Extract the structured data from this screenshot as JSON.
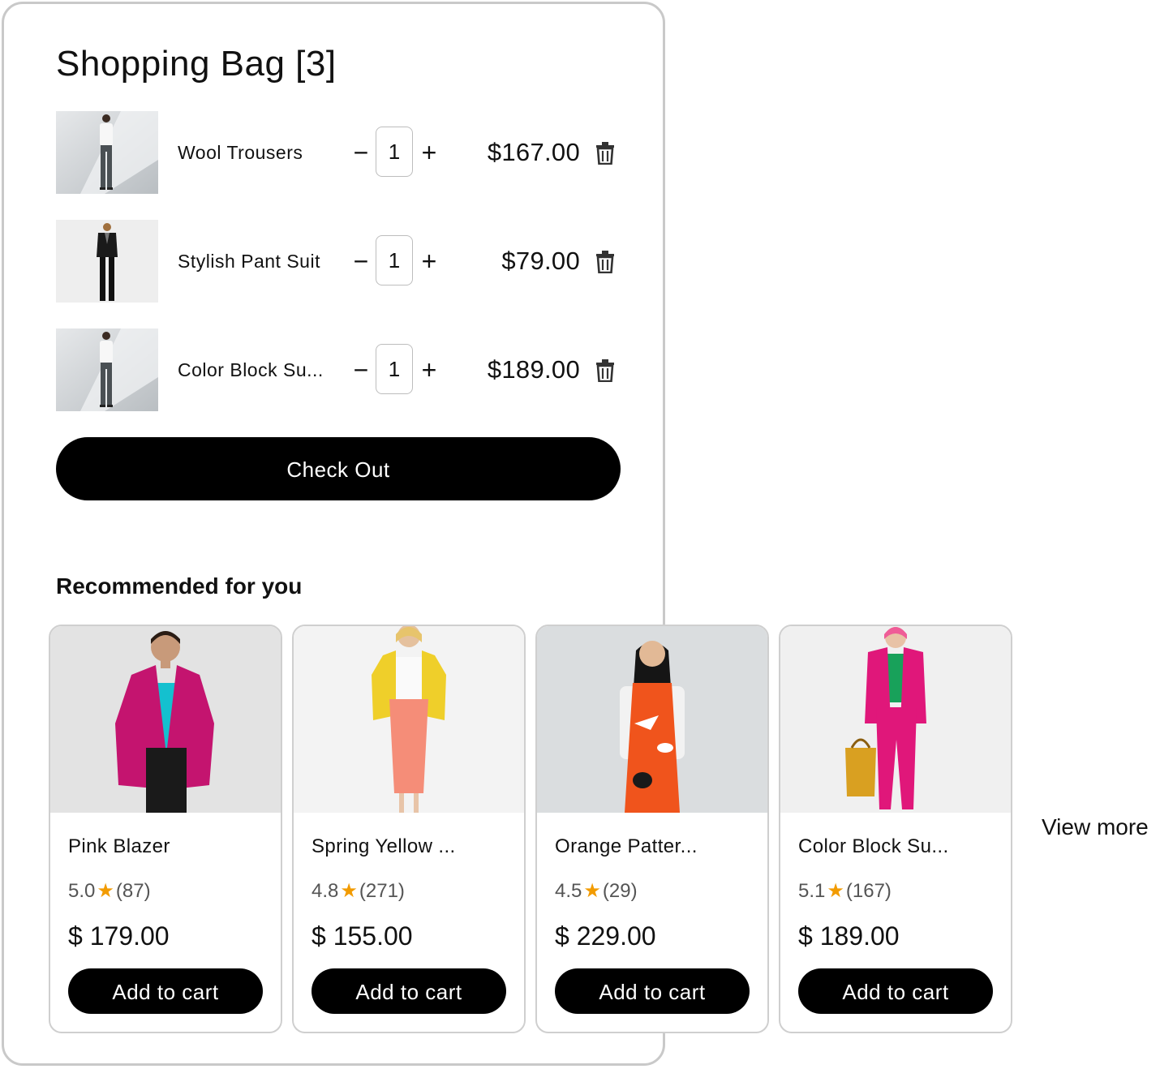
{
  "bag": {
    "title": "Shopping Bag [3]",
    "items": [
      {
        "name": "Wool Trousers",
        "qty": "1",
        "price": "$167.00",
        "image": "woman-white-shirt-gray-trousers"
      },
      {
        "name": "Stylish Pant Suit",
        "qty": "1",
        "price": "$79.00",
        "image": "woman-black-pant-suit"
      },
      {
        "name": "Color Block Su...",
        "qty": "1",
        "price": "$189.00",
        "image": "woman-white-shirt-gray-trousers"
      }
    ],
    "minus_label": "−",
    "plus_label": "+",
    "checkout_label": "Check Out"
  },
  "recommended": {
    "title": "Recommended for you",
    "products": [
      {
        "name": "Pink Blazer",
        "rating": "5.0",
        "reviews": "(87)",
        "price": "$ 179.00",
        "button": "Add to cart",
        "image": "pink-blazer-teal-top"
      },
      {
        "name": "Spring Yellow ...",
        "rating": "4.8",
        "reviews": "(271)",
        "price": "$ 155.00",
        "button": "Add to cart",
        "image": "yellow-blazer-coral-skirt"
      },
      {
        "name": "Orange Patter...",
        "rating": "4.5",
        "reviews": "(29)",
        "price": "$ 229.00",
        "button": "Add to cart",
        "image": "orange-pattern-dress"
      },
      {
        "name": "Color Block Su...",
        "rating": "5.1",
        "reviews": "(167)",
        "price": "$ 189.00",
        "button": "Add to cart",
        "image": "pink-suit-green-shirt-tote"
      }
    ],
    "view_more": "View more"
  },
  "icons": {
    "trash": "trash-icon",
    "star": "star-icon"
  },
  "colors": {
    "accent": "#000000",
    "star": "#f29b00",
    "card_border": "#cfcfcf"
  }
}
